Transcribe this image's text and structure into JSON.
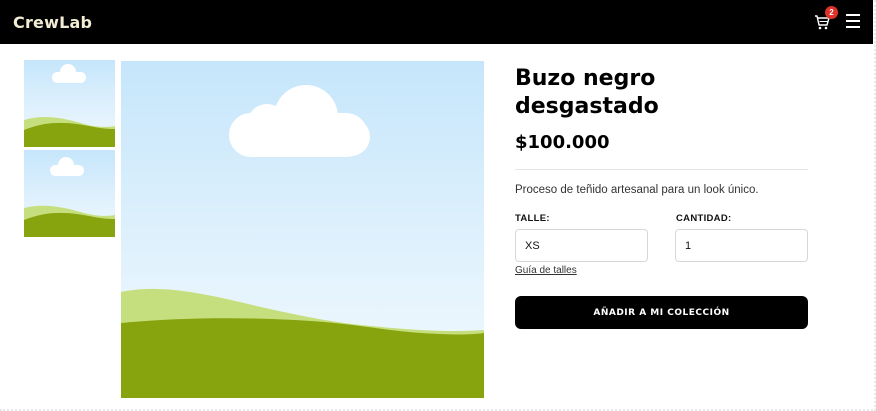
{
  "header": {
    "brand": "CrewLab",
    "cart_count": "2",
    "cart_icon": "shopping-cart-icon",
    "menu_icon": "hamburger-menu-icon"
  },
  "gallery": {
    "thumbnails": [
      "landscape-placeholder",
      "landscape-placeholder"
    ],
    "main_image": "landscape-placeholder",
    "colors": {
      "sky_top": "#c6e6fb",
      "sky_bottom": "#f2f9fe",
      "cloud": "#ffffff",
      "hill_light": "#c6df7e",
      "hill_dark": "#87a30d"
    }
  },
  "product": {
    "title": "Buzo negro desgastado",
    "price": "$100.000",
    "description": "Proceso de teñido artesanal para un look único.",
    "size_label": "TALLE:",
    "size_value": "XS",
    "quantity_label": "CANTIDAD:",
    "quantity_value": "1",
    "size_guide": "Guía de talles",
    "add_button": "AÑADIR A MI COLECCIÓN"
  }
}
